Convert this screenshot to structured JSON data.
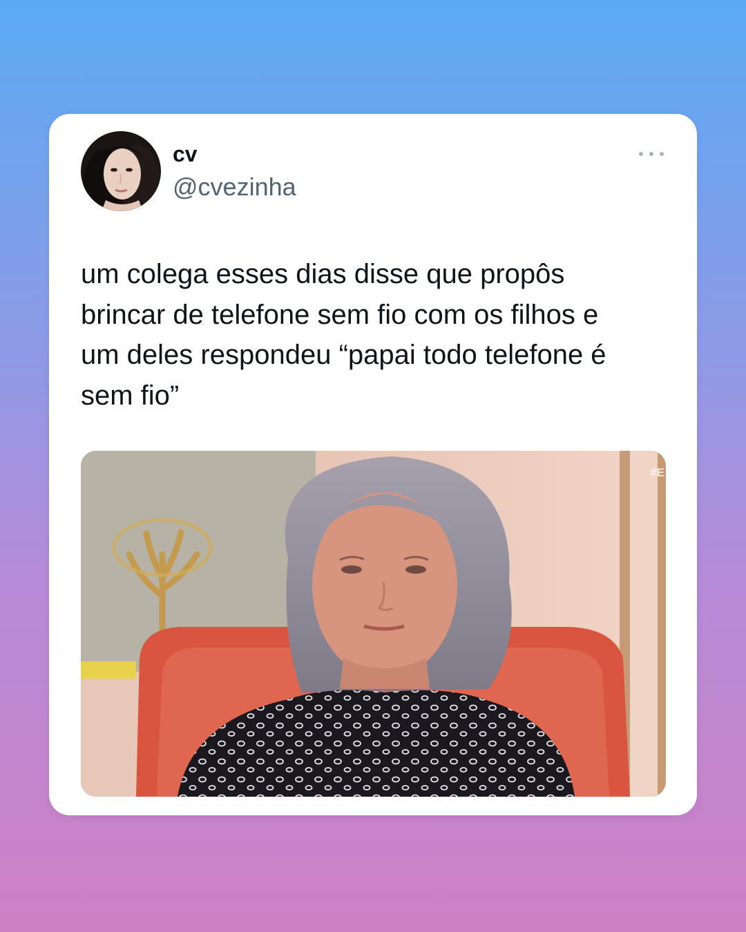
{
  "tweet": {
    "author_name": "cv",
    "author_handle": "@cvezinha",
    "more_icon": "more-horizontal-icon",
    "text": "um colega esses dias disse que propôs\nbrincar de telefone sem fio com os filhos e\num deles respondeu “papai todo telefone é\nsem fio”",
    "media_watermark": "#E"
  },
  "colors": {
    "card_background": "#ffffff",
    "text_primary": "#0f1419",
    "text_secondary": "#536471",
    "gradient_top": "#5aaaf3",
    "gradient_bottom": "#cf80c4"
  }
}
